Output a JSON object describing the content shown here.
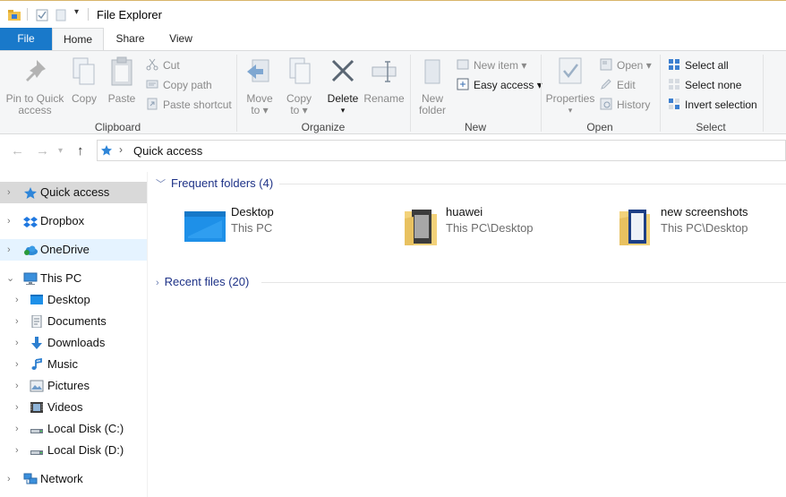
{
  "window": {
    "title": "File Explorer"
  },
  "tabs": {
    "file": "File",
    "home": "Home",
    "share": "Share",
    "view": "View"
  },
  "ribbon": {
    "clipboard": {
      "label": "Clipboard",
      "pin_line1": "Pin to Quick",
      "pin_line2": "access",
      "copy": "Copy",
      "paste": "Paste",
      "cut": "Cut",
      "copy_path": "Copy path",
      "paste_shortcut": "Paste shortcut"
    },
    "organize": {
      "label": "Organize",
      "move_line1": "Move",
      "move_line2": "to",
      "copy_line1": "Copy",
      "copy_line2": "to",
      "delete": "Delete",
      "rename": "Rename"
    },
    "new": {
      "label": "New",
      "new_folder_line1": "New",
      "new_folder_line2": "folder",
      "new_item": "New item",
      "easy_access": "Easy access"
    },
    "open": {
      "label": "Open",
      "properties": "Properties",
      "open": "Open",
      "edit": "Edit",
      "history": "History"
    },
    "select": {
      "label": "Select",
      "select_all": "Select all",
      "select_none": "Select none",
      "invert_selection": "Invert selection"
    }
  },
  "address": {
    "path": "Quick access"
  },
  "sidebar": {
    "items": [
      {
        "label": "Quick access",
        "icon": "star-icon"
      },
      {
        "label": "Dropbox",
        "icon": "dropbox-icon"
      },
      {
        "label": "OneDrive",
        "icon": "cloud-icon"
      },
      {
        "label": "This PC",
        "icon": "computer-icon"
      },
      {
        "label": "Desktop",
        "icon": "desktop-icon"
      },
      {
        "label": "Documents",
        "icon": "documents-icon"
      },
      {
        "label": "Downloads",
        "icon": "download-icon"
      },
      {
        "label": "Music",
        "icon": "music-icon"
      },
      {
        "label": "Pictures",
        "icon": "pictures-icon"
      },
      {
        "label": "Videos",
        "icon": "videos-icon"
      },
      {
        "label": "Local Disk (C:)",
        "icon": "drive-icon"
      },
      {
        "label": "Local Disk (D:)",
        "icon": "drive-icon"
      },
      {
        "label": "Network",
        "icon": "network-icon"
      }
    ]
  },
  "content": {
    "frequent_header": "Frequent folders (4)",
    "recent_header": "Recent files (20)",
    "folders": [
      {
        "name": "Desktop",
        "location": "This PC"
      },
      {
        "name": "huawei",
        "location": "This PC\\Desktop"
      },
      {
        "name": "new screenshots",
        "location": "This PC\\Desktop"
      }
    ]
  },
  "colors": {
    "accent": "#1979ca",
    "header_text": "#1e3287",
    "selected_bg": "#d9d9d9",
    "hover_bg": "#e5f3ff"
  }
}
